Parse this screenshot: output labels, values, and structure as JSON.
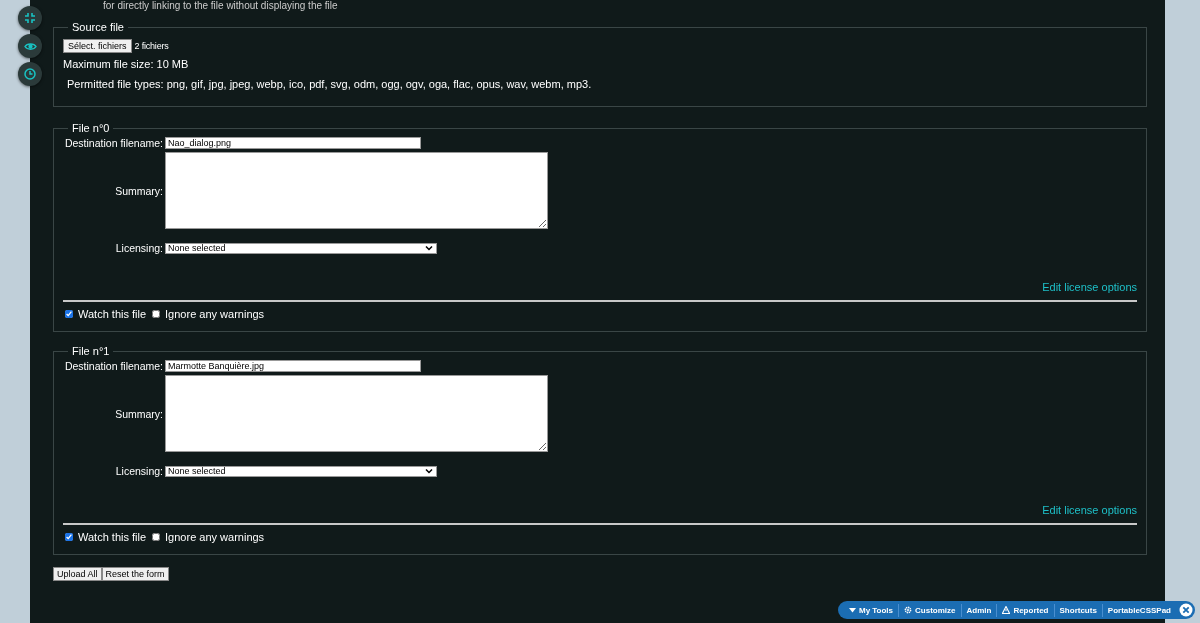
{
  "header_text": "for directly linking to the file without displaying the file",
  "side_buttons": [
    {
      "kind": "collapse"
    },
    {
      "kind": "eye"
    },
    {
      "kind": "clock"
    }
  ],
  "source_file": {
    "legend": "Source file",
    "choose_button": "Sélect. fichiers",
    "chosen": "2 fichiers",
    "max_size": "Maximum file size: 10 MB",
    "permitted": "Permitted file types: png, gif, jpg, jpeg, webp, ico, pdf, svg, odm, ogg, ogv, oga, flac, opus, wav, webm, mp3."
  },
  "files": [
    {
      "legend": "File n°0",
      "dest_label": "Destination filename:",
      "dest_value": "Nao_dialog.png",
      "summary_label": "Summary:",
      "licensing_label": "Licensing:",
      "licensing_value": "None selected",
      "edit_link": "Edit license options",
      "options": [
        {
          "label": "Watch this file",
          "checked": true
        },
        {
          "label": "Ignore any warnings",
          "checked": false
        }
      ]
    },
    {
      "legend": "File n°1",
      "dest_label": "Destination filename:",
      "dest_value": "Marmotte Banquière.jpg",
      "summary_label": "Summary:",
      "licensing_label": "Licensing:",
      "licensing_value": "None selected",
      "edit_link": "Edit license options",
      "options": [
        {
          "label": "Watch this file",
          "checked": true
        },
        {
          "label": "Ignore any warnings",
          "checked": false
        }
      ]
    }
  ],
  "buttons": [
    "Upload All",
    "Reset the form"
  ],
  "toolbar": [
    {
      "label": "My Tools",
      "kind": "menu"
    },
    {
      "label": "Customize",
      "kind": "gear"
    },
    {
      "label": "Admin",
      "kind": "plain"
    },
    {
      "label": "Reported",
      "kind": "warning"
    },
    {
      "label": "Shortcuts",
      "kind": "plain"
    },
    {
      "label": "PortableCSSPad",
      "kind": "plain"
    }
  ]
}
